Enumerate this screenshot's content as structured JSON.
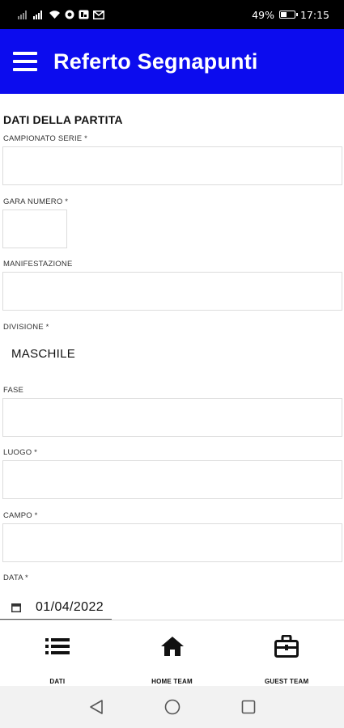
{
  "status_bar": {
    "battery_percent": "49%",
    "battery_level": 0.49,
    "time": "17:15",
    "left_icons": [
      "sim-signal-icon",
      "signal-icon",
      "wifi-icon",
      "notification-icon",
      "app-notification-icon",
      "mail-icon"
    ]
  },
  "app_bar": {
    "title": "Referto Segnapunti",
    "menu_icon": "hamburger-menu-icon",
    "color": "#0c0cee"
  },
  "form": {
    "section_title": "DATI DELLA PARTITA",
    "campionato": {
      "label": "CAMPIONATO SERIE *",
      "value": ""
    },
    "gara_numero": {
      "label": "GARA NUMERO *",
      "value": ""
    },
    "manifestazione": {
      "label": "MANIFESTAZIONE",
      "value": ""
    },
    "divisione": {
      "label": "DIVISIONE *",
      "value": "MASCHILE"
    },
    "fase": {
      "label": "FASE",
      "value": ""
    },
    "luogo": {
      "label": "LUOGO *",
      "value": ""
    },
    "campo": {
      "label": "CAMPO *",
      "value": ""
    },
    "data": {
      "label": "DATA *",
      "value": "01/04/2022",
      "icon": "calendar-icon"
    }
  },
  "bottom_nav": {
    "items": [
      {
        "label": "DATI",
        "icon": "list-icon"
      },
      {
        "label": "HOME TEAM",
        "icon": "home-icon"
      },
      {
        "label": "GUEST TEAM",
        "icon": "briefcase-icon"
      }
    ]
  },
  "system_nav": {
    "buttons": [
      "back-icon",
      "home-circle-icon",
      "recents-icon"
    ]
  }
}
